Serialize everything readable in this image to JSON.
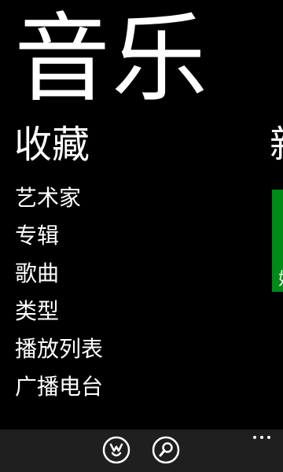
{
  "app": {
    "title": "音乐"
  },
  "collection": {
    "title": "收藏",
    "items": [
      {
        "label": "艺术家"
      },
      {
        "label": "专辑"
      },
      {
        "label": "歌曲"
      },
      {
        "label": "类型"
      },
      {
        "label": "播放列表"
      },
      {
        "label": "广播电台"
      }
    ]
  },
  "next_panel": {
    "title_partial": "新",
    "tile_text_partial": "始",
    "tile_color": "#008a17"
  },
  "app_bar": {
    "background_color": "#1f1f1f",
    "buttons": [
      {
        "icon": "smart-dj-icon"
      },
      {
        "icon": "search-icon"
      }
    ],
    "more_icon": "more-ellipsis-icon"
  }
}
